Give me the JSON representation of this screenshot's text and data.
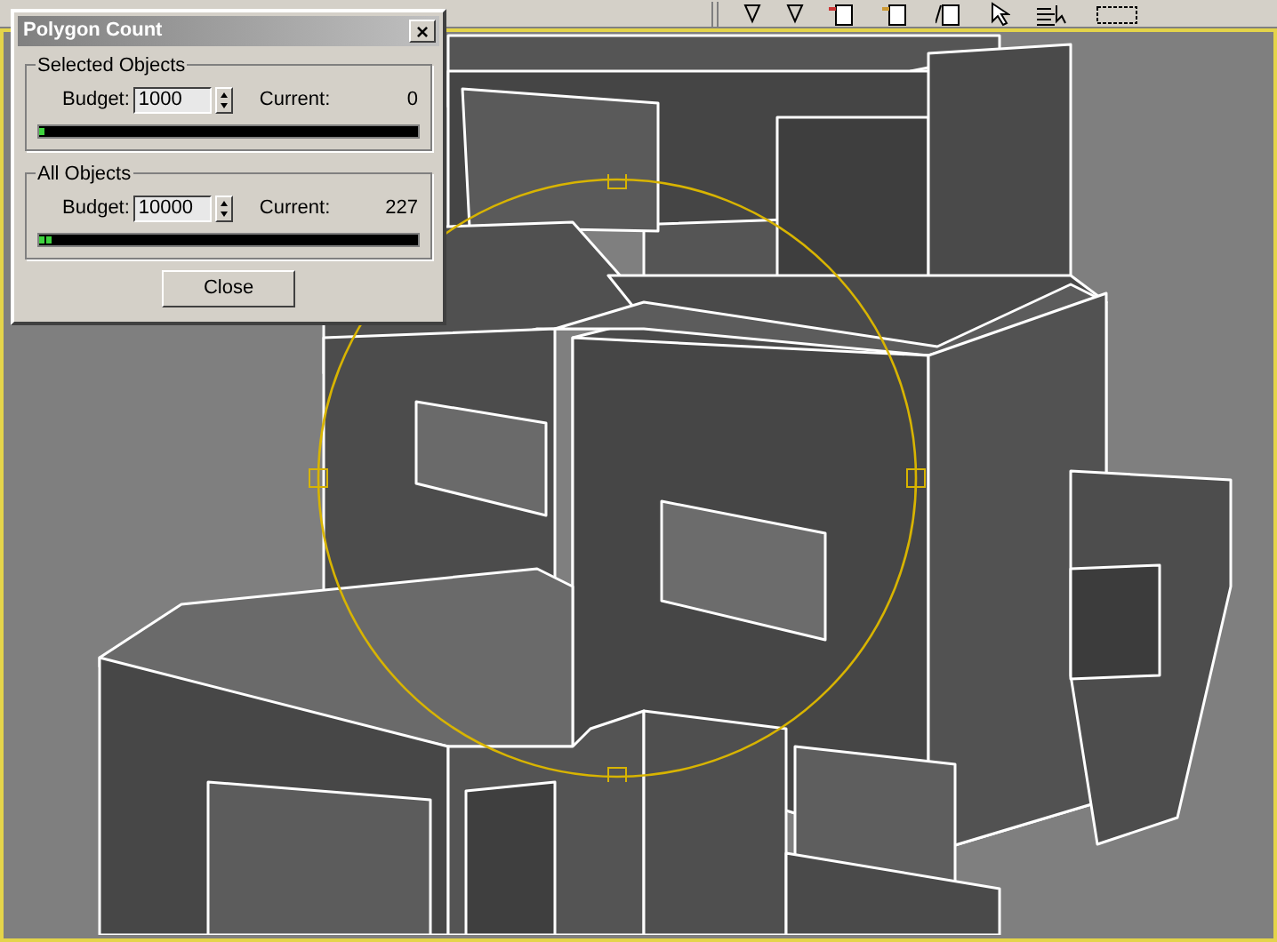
{
  "dialog": {
    "title": "Polygon Count",
    "close_glyph": "×",
    "button": "Close"
  },
  "groups": [
    {
      "label": "Selected Objects",
      "budget_label": "Budget:",
      "budget": "1000",
      "current_label": "Current:",
      "current": "0",
      "level": 0.015
    },
    {
      "label": "All Objects",
      "budget_label": "Budget:",
      "budget": "10000",
      "current_label": "Current:",
      "current": "227",
      "level": 0.035
    }
  ]
}
